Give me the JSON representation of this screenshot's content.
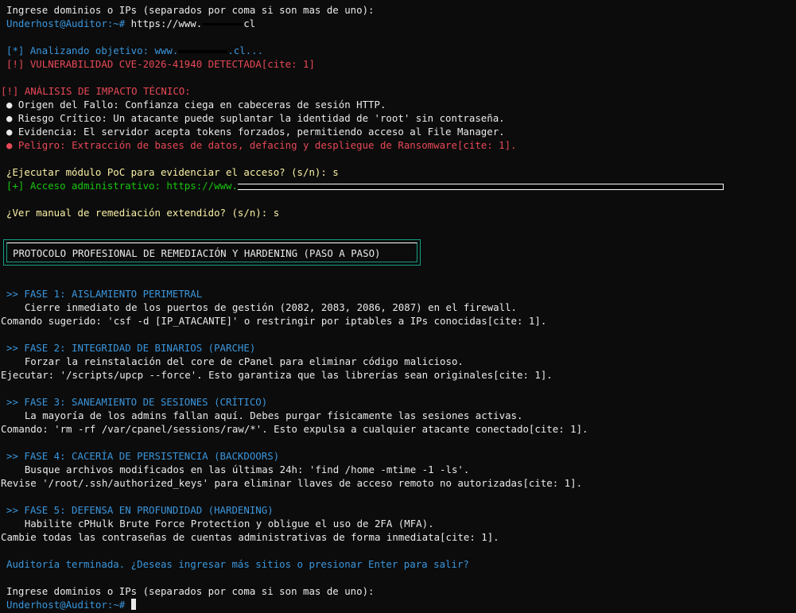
{
  "prompt_ingresar": "Ingrese dominios o IPs (separados por coma si son mas de uno):",
  "shell_prompt": "Underhost@Auditor:~#",
  "url_input_prefix": " https://www.",
  "url_input_suffix": "cl",
  "analizando_prefix": "[*] Analizando objetivo: www.",
  "analizando_suffix": ".cl...",
  "vuln_detectada": "[!] VULNERABILIDAD CVE-2026-41940 DETECTADA[cite: 1]",
  "impacto_title": "[!] ANÁLISIS DE IMPACTO TÉCNICO:",
  "impacto": [
    {
      "bullet": "●",
      "text": " Origen del Fallo: Confianza ciega en cabeceras de sesión HTTP.",
      "color": "white"
    },
    {
      "bullet": "●",
      "text": " Riesgo Crítico: Un atacante puede suplantar la identidad de 'root' sin contraseña.",
      "color": "white"
    },
    {
      "bullet": "●",
      "text": " Evidencia: El servidor acepta tokens forzados, permitiendo acceso al File Manager.",
      "color": "white"
    },
    {
      "bullet": "●",
      "text": " Peligro: Extracción de bases de datos, defacing y despliegue de Ransomware[cite: 1].",
      "color": "red"
    }
  ],
  "poc_question": "¿Ejecutar módulo PoC para evidenciar el acceso? (s/n): s",
  "acceso_admin_prefix": "[+] Acceso administrativo: https://www.",
  "manual_question": "¿Ver manual de remediación extendido? (s/n): s",
  "protocolo_title": "PROTOCOLO PROFESIONAL DE REMEDIACIÓN Y HARDENING (PASO A PASO)",
  "fases": [
    {
      "title": ">> FASE 1: AISLAMIENTO PERIMETRAL",
      "line1": "    Cierre inmediato de los puertos de gestión (2082, 2083, 2086, 2087) en el firewall.",
      "line2": "Comando sugerido: 'csf -d [IP_ATACANTE]' o restringir por iptables a IPs conocidas[cite: 1]."
    },
    {
      "title": ">> FASE 2: INTEGRIDAD DE BINARIOS (PARCHE)",
      "line1": "    Forzar la reinstalación del core de cPanel para eliminar código malicioso.",
      "line2": "Ejecutar: '/scripts/upcp --force'. Esto garantiza que las librerías sean originales[cite: 1]."
    },
    {
      "title": ">> FASE 3: SANEAMIENTO DE SESIONES (CRÍTICO)",
      "line1": "    La mayoría de los admins fallan aquí. Debes purgar físicamente las sesiones activas.",
      "line2": "Comando: 'rm -rf /var/cpanel/sessions/raw/*'. Esto expulsa a cualquier atacante conectado[cite: 1]."
    },
    {
      "title": ">> FASE 4: CACERÍA DE PERSISTENCIA (BACKDOORS)",
      "line1": "    Busque archivos modificados en las últimas 24h: 'find /home -mtime -1 -ls'.",
      "line2": "Revise '/root/.ssh/authorized_keys' para eliminar llaves de acceso remoto no autorizadas[cite: 1]."
    },
    {
      "title": ">> FASE 5: DEFENSA EN PROFUNDIDAD (HARDENING)",
      "line1": "    Habilite cPHulk Brute Force Protection y obligue el uso de 2FA (MFA).",
      "line2": "Cambie todas las contraseñas de cuentas administrativas de forma inmediata[cite: 1]."
    }
  ],
  "auditoria_terminada": "Auditoría terminada. ¿Deseas ingresar más sitios o presionar Enter para salir?",
  "prompt_ingresar_2": "Ingrese dominios o IPs (separados por coma si son mas de uno):",
  "shell_prompt_2": "Underhost@Auditor:~#"
}
